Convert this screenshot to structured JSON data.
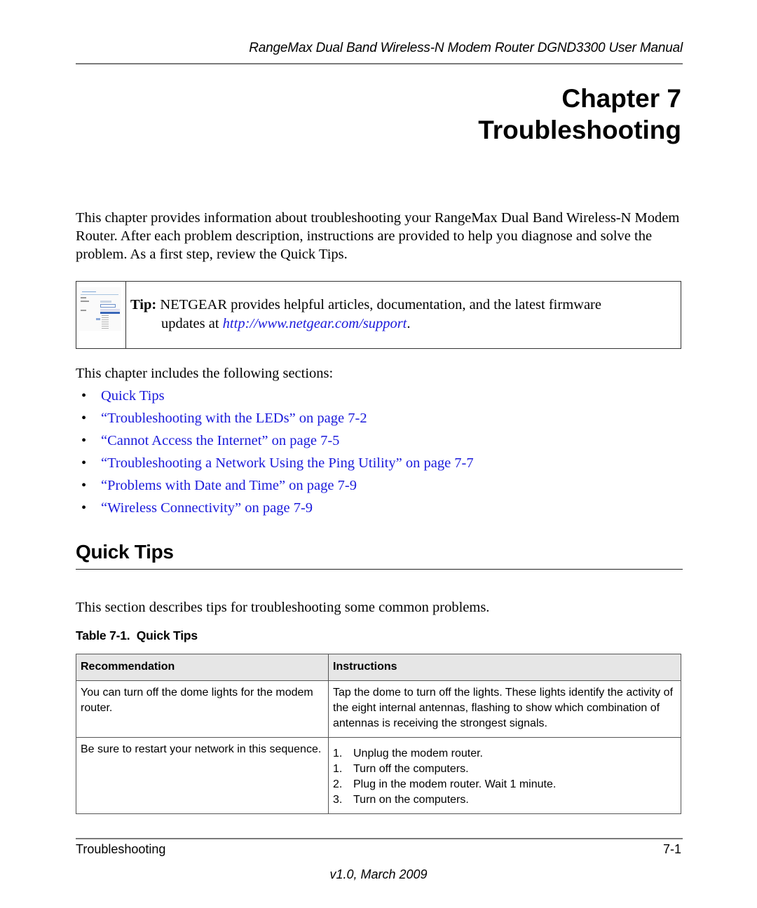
{
  "header": {
    "running_title": "RangeMax Dual Band Wireless-N Modem Router DGND3300 User Manual"
  },
  "chapter": {
    "number_label": "Chapter 7",
    "title": "Troubleshooting"
  },
  "intro": {
    "text": "This chapter provides information about troubleshooting your RangeMax Dual Band Wireless-N Modem Router. After each problem description, instructions are provided to help you diagnose and solve the problem. As a first step, review the Quick Tips."
  },
  "tip": {
    "thumbnail_icon": "screenshot-thumbnail-icon",
    "label": "Tip:",
    "text_before_link": " NETGEAR provides helpful articles, documentation, and the latest firmware",
    "line2_prefix": "updates at ",
    "url": "http://www.netgear.com/support",
    "line2_suffix": "."
  },
  "sections": {
    "intro": "This chapter includes the following sections:",
    "bullet": "•",
    "items": [
      {
        "label": "Quick Tips"
      },
      {
        "label": "“Troubleshooting with the LEDs” on page 7-2"
      },
      {
        "label": "“Cannot Access the Internet” on page 7-5"
      },
      {
        "label": "“Troubleshooting a Network Using the Ping Utility” on page 7-7"
      },
      {
        "label": "“Problems with Date and Time” on page 7-9"
      },
      {
        "label": "“Wireless Connectivity” on page 7-9"
      }
    ]
  },
  "quick_tips": {
    "heading": "Quick Tips",
    "description": "This section describes tips for troubleshooting some common problems.",
    "table_caption": "Table 7-1.  Quick Tips",
    "columns": [
      "Recommendation",
      "Instructions"
    ],
    "rows": [
      {
        "recommendation": "You can turn off the dome lights for the modem router.",
        "instructions": "Tap the dome to turn off the lights. These lights identify the activity of the eight internal antennas, flashing to show which combination of antennas is receiving the strongest signals."
      },
      {
        "recommendation": "Be sure to restart your network in this sequence.",
        "steps": [
          {
            "num": "1.",
            "text": "Unplug the modem router."
          },
          {
            "num": "1.",
            "text": "Turn off the computers."
          },
          {
            "num": "2.",
            "text": "Plug in the modem router. Wait 1 minute."
          },
          {
            "num": "3.",
            "text": "Turn on the computers."
          }
        ]
      }
    ]
  },
  "footer": {
    "section": "Troubleshooting",
    "page": "7-1",
    "version": "v1.0, March 2009"
  },
  "colors": {
    "link": "#1a1adb",
    "table_header_bg": "#e6e6e6",
    "rule": "#7a7a7a"
  }
}
